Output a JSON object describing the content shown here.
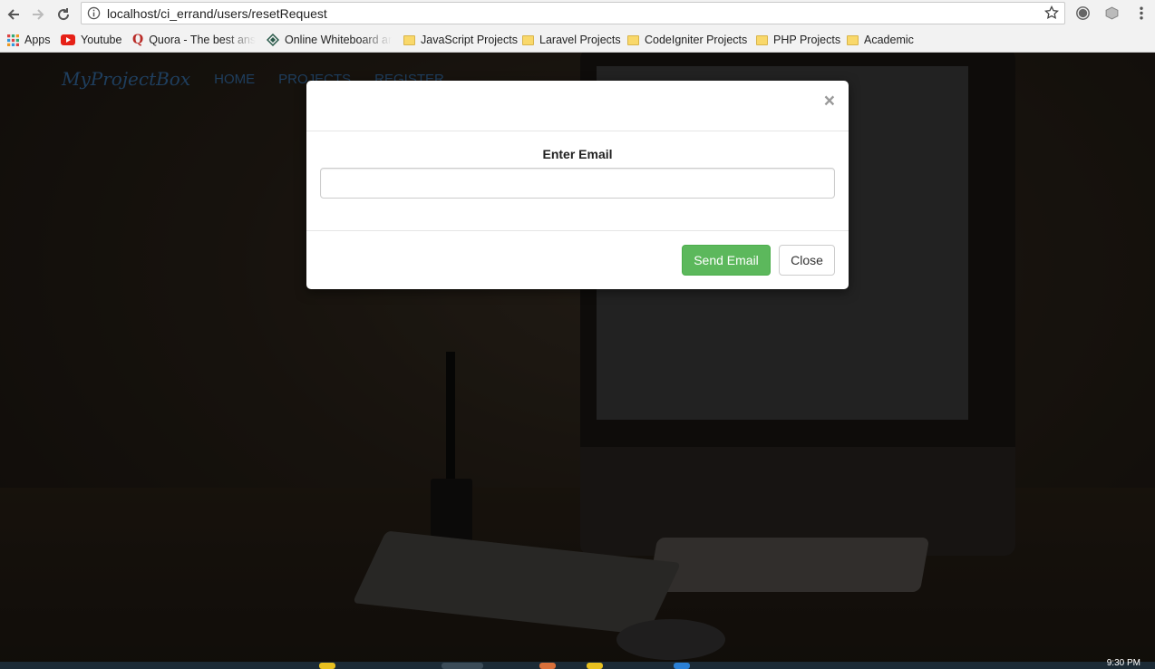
{
  "browser": {
    "url": "localhost/ci_errand/users/resetRequest",
    "bookmarks": [
      {
        "label": "Apps",
        "icon": "apps-grid-icon"
      },
      {
        "label": "Youtube",
        "icon": "youtube-icon"
      },
      {
        "label": "Quora - The best answ",
        "icon": "quora-icon"
      },
      {
        "label": "Online Whiteboard an",
        "icon": "whiteboard-icon"
      },
      {
        "label": "JavaScript Projects",
        "icon": "folder-icon"
      },
      {
        "label": "Laravel Projects",
        "icon": "folder-icon"
      },
      {
        "label": "CodeIgniter Projects",
        "icon": "folder-icon"
      },
      {
        "label": "PHP Projects",
        "icon": "folder-icon"
      },
      {
        "label": "Academic",
        "icon": "folder-icon"
      }
    ]
  },
  "site": {
    "brand": "MyProjectBox",
    "nav": [
      "HOME",
      "PROJECTS",
      "REGISTER"
    ]
  },
  "modal": {
    "close_symbol": "×",
    "label": "Enter Email",
    "email_value": "",
    "send_label": "Send Email",
    "close_label": "Close"
  },
  "taskbar": {
    "clock": "9:30 PM"
  },
  "colors": {
    "send_button": "#5cb85c",
    "nav_link": "#1f3f5f"
  }
}
